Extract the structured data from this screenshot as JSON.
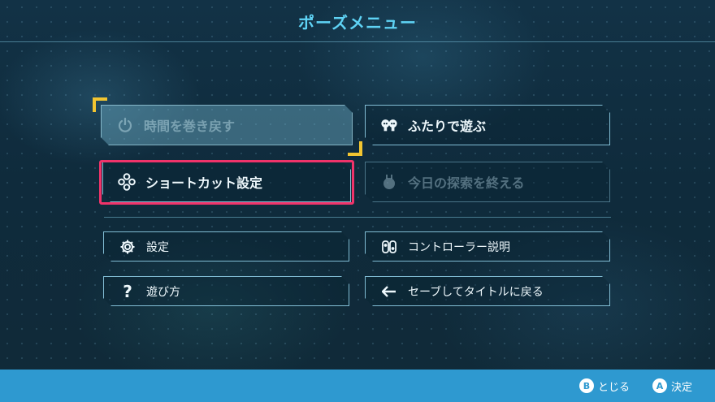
{
  "title": "ポーズメニュー",
  "menu": {
    "rewind": {
      "label": "時間を巻き戻す",
      "icon": "power-icon"
    },
    "two_player": {
      "label": "ふたりで遊ぶ",
      "icon": "two-players-icon"
    },
    "shortcut": {
      "label": "ショートカット設定",
      "icon": "dpad-icon"
    },
    "end_exploration": {
      "label": "今日の探索を終える",
      "icon": "character-icon"
    },
    "settings": {
      "label": "設定",
      "icon": "gear-icon"
    },
    "controls": {
      "label": "コントローラー説明",
      "icon": "joycon-icon"
    },
    "how_to_play": {
      "label": "遊び方",
      "icon": "question-icon"
    },
    "save_title": {
      "label": "セーブしてタイトルに戻る",
      "icon": "arrow-left-icon"
    }
  },
  "footer": {
    "close": {
      "key": "B",
      "label": "とじる"
    },
    "confirm": {
      "key": "A",
      "label": "決定"
    }
  },
  "colors": {
    "accent": "#5fd3f5",
    "highlight": "#f0336a",
    "cursor": "#f2c531",
    "footer": "#2e99d0"
  }
}
